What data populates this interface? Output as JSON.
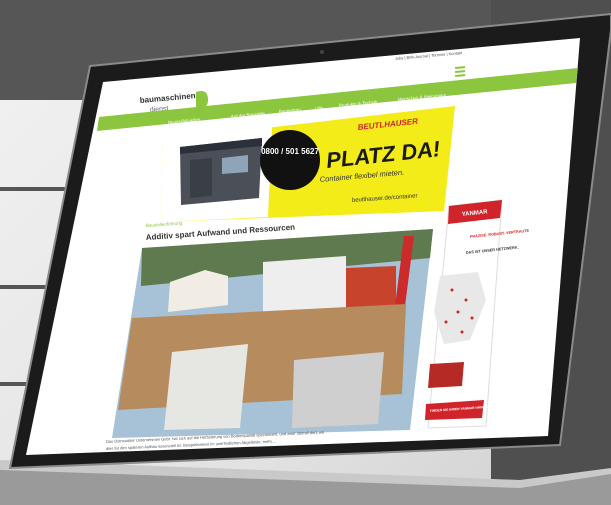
{
  "site": {
    "logo_line1": "baumaschinen",
    "logo_line2": "dienst",
    "top_links": "Jobs | BMI-Journal | Termine | Kontakt",
    "nav": [
      "Neues/Aktuelles",
      "Auf der Baustelle",
      "Baggerbau",
      "Lifts",
      "Produkte & Technik",
      "Menschen & Meinungen"
    ]
  },
  "banner": {
    "phone": "0800 / 501 5627",
    "brand": "BEUTLHAUSER",
    "headline": "PLATZ DA!",
    "sub": "Container flexibel mieten.",
    "url": "beutlhauser.de/container"
  },
  "article": {
    "tag": "Baustellenführung",
    "title": "Additiv spart Aufwand und Ressourcen",
    "caption_line1": "Das Ostneuölter Unternehmen Gebr. hat sich auf die Herbsterung von Bodenqualität spezialisiert, und zwar überall dort, wo",
    "caption_line2": "dies für den späteren Aufbau essenziell ist. Beispielsweise im unerfindlichen Abgelände. mehr ..."
  },
  "side_ad": {
    "brand": "YANMAR",
    "text1": "PRÄZISE. ROBUST. VERTRAUTE",
    "text2": "DAS IST UNSER NETZWERK.",
    "cta": "FINDEN SIE IHREN YANMAR HÄNDLER"
  },
  "colors": {
    "accent_green": "#8cc63f",
    "banner_yellow": "#f3ec19",
    "yanmar_red": "#d0232a"
  }
}
